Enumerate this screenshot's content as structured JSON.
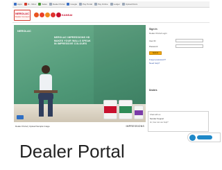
{
  "browser": {
    "bookmarks": [
      "Apps",
      "M - Inbox",
      "Sales",
      "Dealer Portal",
      "Google",
      "Pay Portal",
      "Pay Online",
      "Ledger",
      "Upload Docs"
    ]
  },
  "header": {
    "brand_top": "NEROLAC",
    "brand_bottom": "Dealer Connect",
    "logo_text": "KANSAI"
  },
  "hero": {
    "logo": "NEROLAC",
    "headline": [
      "NEROLAC IMPRESSIONS HD",
      "MAKES YOUR WALLS SPEAK",
      "IN IMPRESSIVE COLOURS"
    ],
    "caption": "Dealer Portal | Upload Sample Image",
    "brand_wordmark": "IMPRESSIONS"
  },
  "login": {
    "title": "Sign In",
    "subtitle": "Dealer Portal Login",
    "username_label": "User ID",
    "password_label": "Password",
    "button_label": "Submit",
    "link_forgot": "Forgot password?",
    "link_help": "Need help?",
    "section_heading": "Dealers"
  },
  "popup": {
    "header": "Chat with us",
    "title": "Nerolac Support",
    "line": "Hi, how can we help?"
  },
  "footer": {
    "title": "Dealer Portal"
  }
}
